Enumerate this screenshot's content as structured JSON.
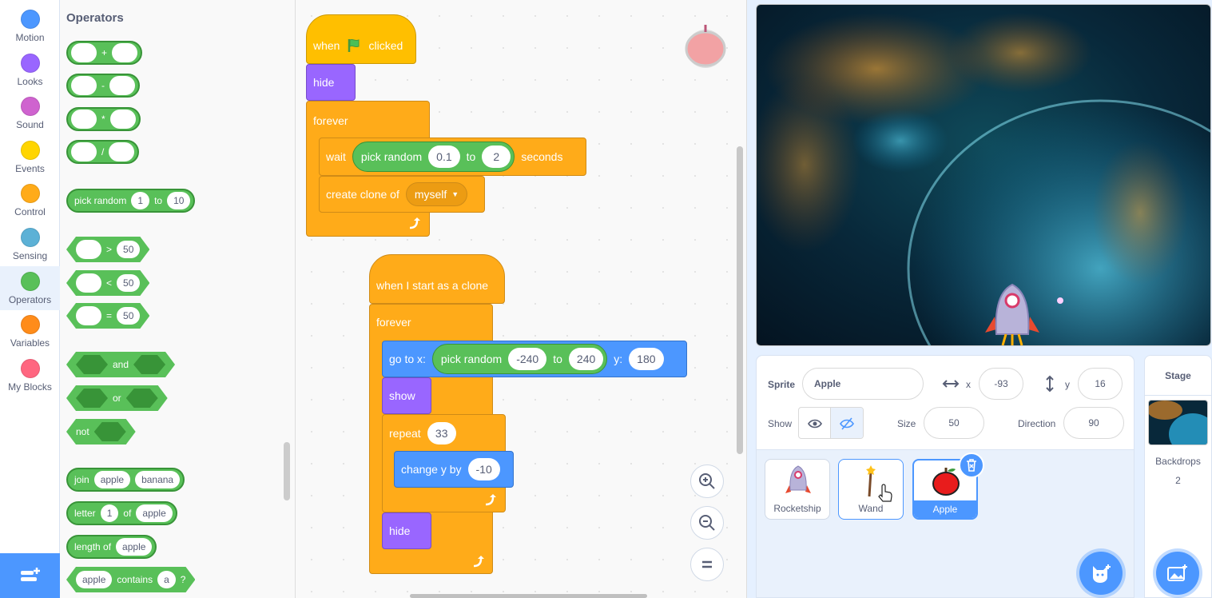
{
  "categories": [
    {
      "label": "Motion",
      "color": "#4c97ff"
    },
    {
      "label": "Looks",
      "color": "#9966ff"
    },
    {
      "label": "Sound",
      "color": "#cf63cf"
    },
    {
      "label": "Events",
      "color": "#ffd500"
    },
    {
      "label": "Control",
      "color": "#ffab19"
    },
    {
      "label": "Sensing",
      "color": "#5cb1d6"
    },
    {
      "label": "Operators",
      "color": "#59c059"
    },
    {
      "label": "Variables",
      "color": "#ff8c1a"
    },
    {
      "label": "My Blocks",
      "color": "#ff6680"
    }
  ],
  "palette": {
    "title": "Operators",
    "add": "+",
    "sub": "-",
    "mul": "*",
    "div": "/",
    "pick_random": {
      "label": "pick random",
      "from": "1",
      "to_label": "to",
      "to": "10"
    },
    "gt": ">",
    "lt": "<",
    "eq": "=",
    "cmp_value": "50",
    "and": "and",
    "or": "or",
    "not": "not",
    "join": {
      "label": "join",
      "a": "apple",
      "b": "banana"
    },
    "letter": {
      "label": "letter",
      "n": "1",
      "of": "of",
      "word": "apple"
    },
    "length": {
      "label": "length of",
      "word": "apple"
    },
    "contains": {
      "word": "apple",
      "label": "contains",
      "ch": "a",
      "q": "?"
    }
  },
  "script1": {
    "when": "when",
    "clicked": "clicked",
    "hide": "hide",
    "forever": "forever",
    "wait": "wait",
    "pick": "pick random",
    "from": "0.1",
    "to": "to",
    "to_val": "2",
    "seconds": "seconds",
    "create_clone": "create clone of",
    "clone_target": "myself"
  },
  "script2": {
    "hat": "when I start as a clone",
    "forever": "forever",
    "goto": "go to x:",
    "pick": "pick random",
    "from": "-240",
    "to": "to",
    "to_val": "240",
    "y": "y:",
    "y_val": "180",
    "show": "show",
    "repeat": "repeat",
    "repeat_n": "33",
    "change_y": "change y by",
    "change_val": "-10",
    "hide": "hide"
  },
  "sprite_info": {
    "sprite_label": "Sprite",
    "name": "Apple",
    "x_label": "x",
    "x": "-93",
    "y_label": "y",
    "y": "16",
    "show_label": "Show",
    "size_label": "Size",
    "size": "50",
    "direction_label": "Direction",
    "direction": "90"
  },
  "sprites": [
    {
      "name": "Rocketship"
    },
    {
      "name": "Wand"
    },
    {
      "name": "Apple"
    }
  ],
  "stage_pane": {
    "title": "Stage",
    "backdrops_label": "Backdrops",
    "backdrops": "2"
  }
}
